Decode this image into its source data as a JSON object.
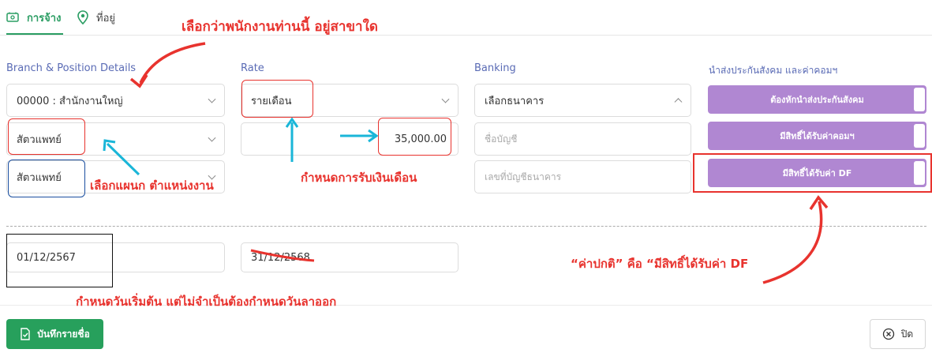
{
  "tabs": {
    "employment": "การจ้าง",
    "address": "ที่อยู่"
  },
  "sections": {
    "branch_position": "Branch & Position Details",
    "rate": "Rate",
    "banking": "Banking",
    "social_security": "นำส่งประกันสังคม และค่าคอมฯ"
  },
  "fields": {
    "branch": "00000 : สำนักงานใหญ่",
    "department": "สัตวแพทย์",
    "position": "สัตวแพทย์",
    "rate_type": "รายเดือน",
    "salary": "35,000.00",
    "bank_select": "เลือกธนาคาร",
    "account_name_placeholder": "ชื่อบัญชี",
    "account_number_placeholder": "เลขที่บัญชีธนาคาร",
    "start_date": "01/12/2567",
    "end_date": "31/12/2568"
  },
  "toggles": {
    "social_security": "ต้องหักนำส่งประกันสังคม",
    "commission": "มีสิทธิ์ได้รับค่าคอมฯ",
    "df": "มีสิทธิ์ได้รับค่า DF"
  },
  "annotations": {
    "branch_note": "เลือกว่าพนักงานท่านนี้ อยู่สาขาใด",
    "department_note": "เลือกแผนก ตำแหน่งงาน",
    "salary_note": "กำหนดการรับเงินเดือน",
    "df_note": "“ค่าปกติ” คือ “มีสิทธิ์ได้รับค่า DF",
    "date_note": "กำหนดวันเริ่มต้น แต่ไม่จำเป็นต้องกำหนดวันลาออก"
  },
  "footer": {
    "save": "บันทึกรายชื่อ",
    "close": "ปิด"
  },
  "icons": {
    "employment_tab": "id-card-icon",
    "address_tab": "map-pin-icon",
    "save": "save-doc-icon",
    "close": "close-circle-icon"
  },
  "colors": {
    "accent_green": "#2a9d63",
    "section_blue": "#5a6bb5",
    "toggle_purple": "#b087d2",
    "annotation_red": "#e8332e",
    "annotation_cyan": "#1ab6d8"
  }
}
